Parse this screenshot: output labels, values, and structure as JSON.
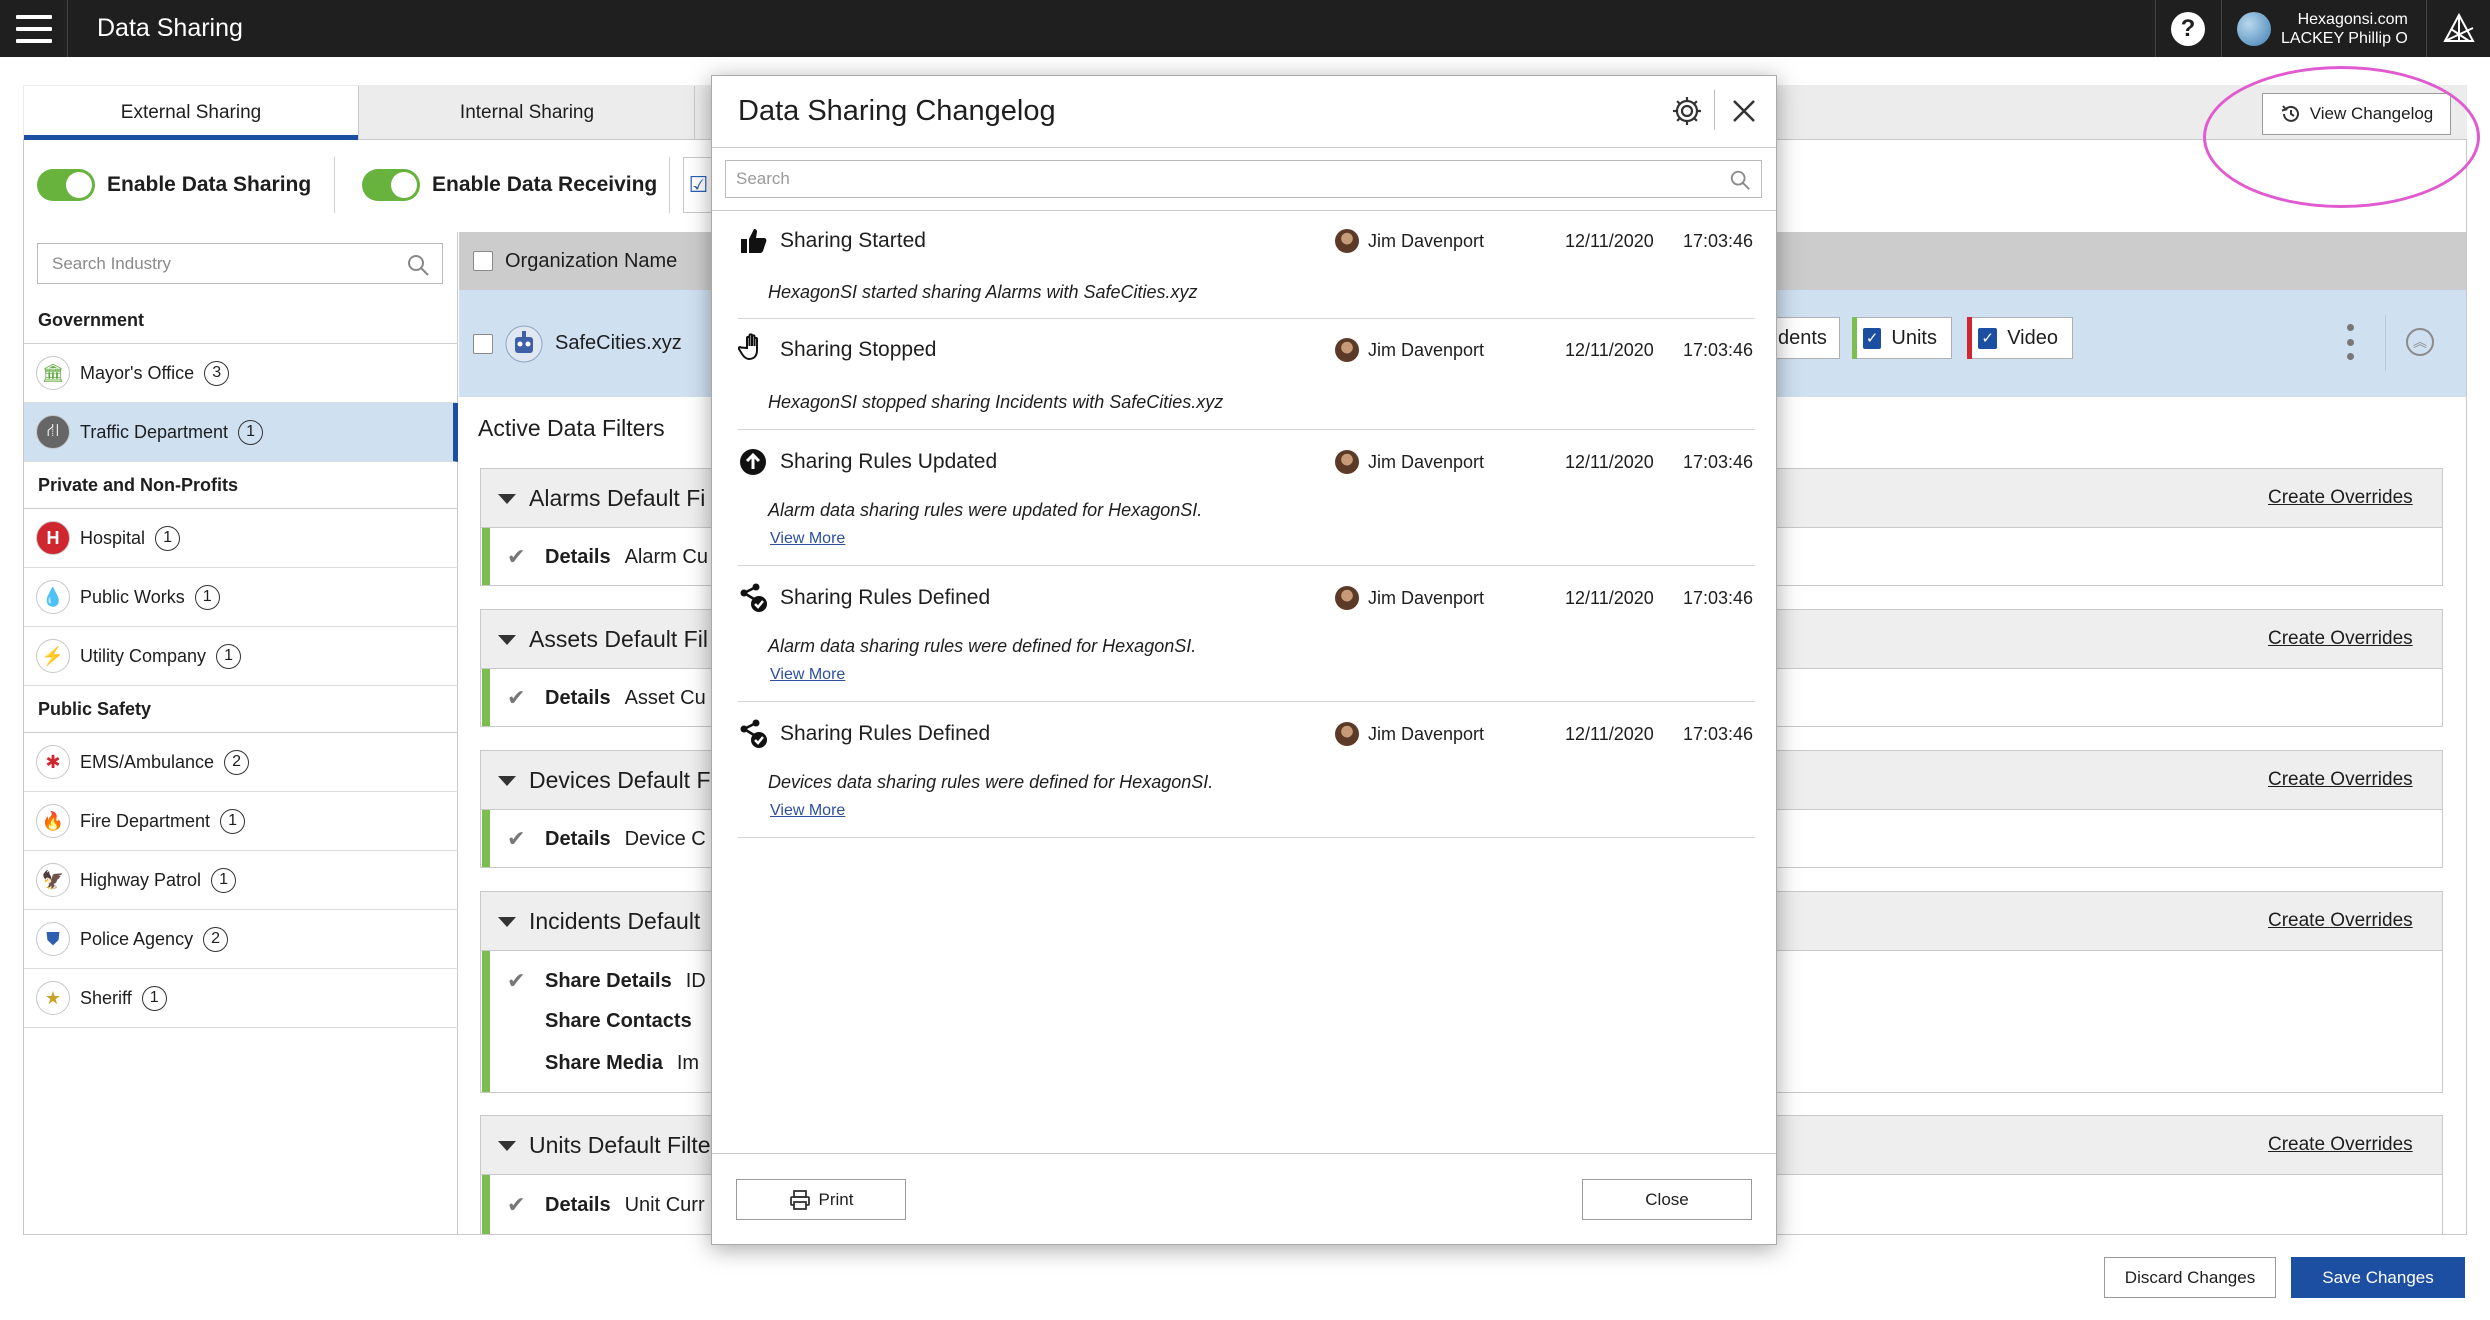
{
  "app": {
    "title": "Data Sharing"
  },
  "user": {
    "domain": "Hexagonsi.com",
    "name": "LACKEY Phillip O"
  },
  "tabs": [
    {
      "label": "External Sharing"
    },
    {
      "label": "Internal Sharing"
    }
  ],
  "view_changelog_label": "View Changelog",
  "toggles": {
    "sharing_label": "Enable Data Sharing",
    "receiving_label": "Enable Data Receiving"
  },
  "sidebar": {
    "search_placeholder": "Search Industry",
    "categories": [
      {
        "name": "Government",
        "items": [
          {
            "label": "Mayor's Office",
            "count": "3",
            "icon": "government-building-icon"
          },
          {
            "label": "Traffic Department",
            "count": "1",
            "icon": "road-icon"
          }
        ]
      },
      {
        "name": "Private and Non-Profits",
        "items": [
          {
            "label": "Hospital",
            "count": "1",
            "icon": "hospital-icon"
          },
          {
            "label": "Public Works",
            "count": "1",
            "icon": "water-drop-icon"
          },
          {
            "label": "Utility Company",
            "count": "1",
            "icon": "lightning-icon"
          }
        ]
      },
      {
        "name": "Public Safety",
        "items": [
          {
            "label": "EMS/Ambulance",
            "count": "2",
            "icon": "star-of-life-icon"
          },
          {
            "label": "Fire Department",
            "count": "1",
            "icon": "flame-icon"
          },
          {
            "label": "Highway Patrol",
            "count": "1",
            "icon": "eagle-badge-icon"
          },
          {
            "label": "Police Agency",
            "count": "2",
            "icon": "police-badge-icon"
          },
          {
            "label": "Sheriff",
            "count": "1",
            "icon": "sheriff-star-icon"
          }
        ]
      }
    ]
  },
  "organizations": {
    "header": "Organization Name",
    "rows": [
      {
        "name": "SafeCities.xyz",
        "chips": [
          "dents",
          "Units",
          "Video"
        ]
      }
    ]
  },
  "filters": {
    "title": "Active Data Filters",
    "create_overrides_label": "Create Overrides",
    "groups": [
      {
        "title": "Alarms Default Fi",
        "details": [
          {
            "label": "Details",
            "value": "Alarm Cu"
          }
        ]
      },
      {
        "title": "Assets Default Fil",
        "details": [
          {
            "label": "Details",
            "value": "Asset Cu"
          }
        ]
      },
      {
        "title": "Devices Default F",
        "details": [
          {
            "label": "Details",
            "value": "Device C"
          }
        ]
      },
      {
        "title": "Incidents Default",
        "details": [
          {
            "label": "Share Details",
            "value": "ID"
          },
          {
            "label": "Share Contacts",
            "value": ""
          },
          {
            "label": "Share Media",
            "value": "Im"
          }
        ]
      },
      {
        "title": "Units Default Filte",
        "details": [
          {
            "label": "Details",
            "value": "Unit Curr"
          }
        ]
      }
    ]
  },
  "footer": {
    "discard_label": "Discard Changes",
    "save_label": "Save Changes"
  },
  "modal": {
    "title": "Data Sharing Changelog",
    "search_placeholder": "Search",
    "entries": [
      {
        "title": "Sharing Started",
        "icon": "thumbs-up-icon",
        "user": "Jim Davenport",
        "date": "12/11/2020",
        "time": "17:03:46",
        "description": "HexagonSI started sharing Alarms with SafeCities.xyz",
        "link": ""
      },
      {
        "title": "Sharing Stopped",
        "icon": "stop-hand-icon",
        "user": "Jim Davenport",
        "date": "12/11/2020",
        "time": "17:03:46",
        "description": "HexagonSI stopped sharing Incidents with SafeCities.xyz",
        "link": ""
      },
      {
        "title": "Sharing Rules Updated",
        "icon": "arrow-up-circle-icon",
        "user": "Jim Davenport",
        "date": "12/11/2020",
        "time": "17:03:46",
        "description": "Alarm data sharing rules were updated for HexagonSI.",
        "link": "View More"
      },
      {
        "title": "Sharing Rules Defined",
        "icon": "share-check-icon",
        "user": "Jim Davenport",
        "date": "12/11/2020",
        "time": "17:03:46",
        "description": "Alarm data sharing rules were defined for HexagonSI.",
        "link": "View More"
      },
      {
        "title": "Sharing Rules Defined",
        "icon": "share-check-icon",
        "user": "Jim Davenport",
        "date": "12/11/2020",
        "time": "17:03:46",
        "description": "Devices data sharing rules were defined for HexagonSI.",
        "link": "View More"
      }
    ],
    "print_label": "Print",
    "close_label": "Close"
  },
  "colors": {
    "accent": "#1c4ea2",
    "toggle_on": "#67b33e",
    "highlight": "#e15bd0",
    "topbar": "#1f1f1f",
    "selected_row": "#cfe0f1"
  }
}
